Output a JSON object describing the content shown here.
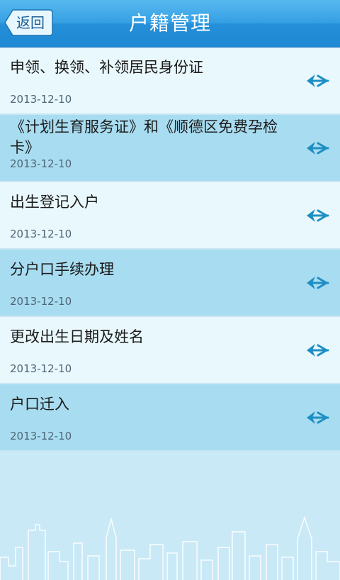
{
  "header": {
    "title": "户籍管理",
    "back_label": "返回"
  },
  "items": [
    {
      "title": "申领、换领、补领居民身份证",
      "date": "2013-12-10"
    },
    {
      "title": "《计划生育服务证》和《顺德区免费孕检卡》",
      "date": "2013-12-10"
    },
    {
      "title": "出生登记入户",
      "date": "2013-12-10"
    },
    {
      "title": "分户口手续办理",
      "date": "2013-12-10"
    },
    {
      "title": "更改出生日期及姓名",
      "date": "2013-12-10"
    },
    {
      "title": "户口迁入",
      "date": "2013-12-10"
    }
  ],
  "colors": {
    "header": "#258fd9",
    "row_light": "#e9f8fd",
    "row_dark": "#a8dcf1",
    "arrow": "#1e8fc4"
  },
  "icons": {
    "row_arrow": "chevron-arrow-icon",
    "back": "back-arrow-icon"
  }
}
